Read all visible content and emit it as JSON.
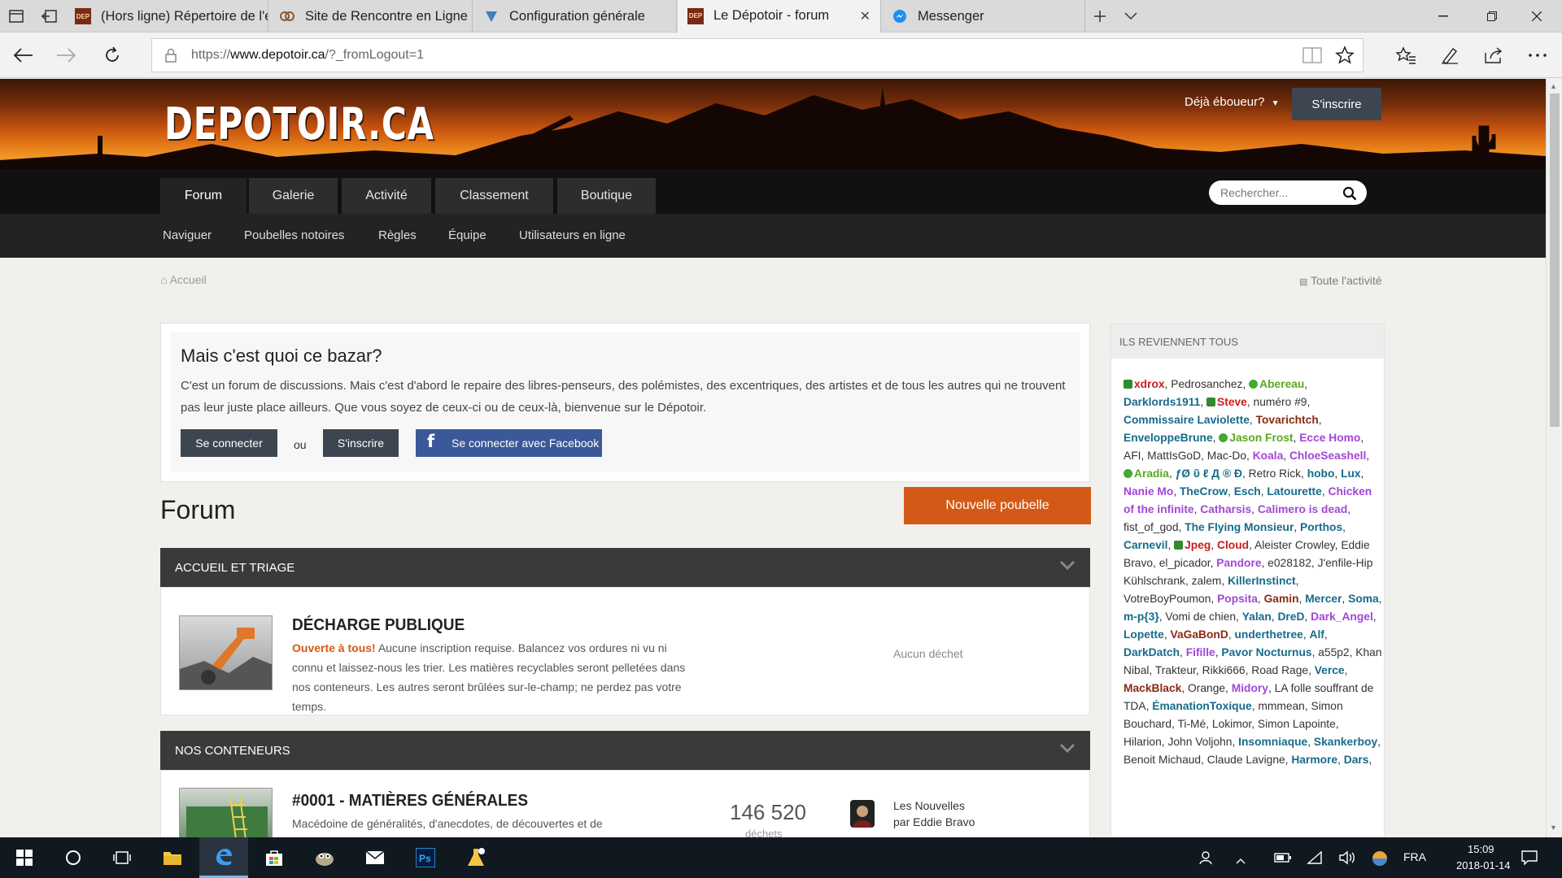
{
  "browser": {
    "tabs": [
      {
        "title": "(Hors ligne) Répertoire de l'é",
        "icon": "depotoir-favicon"
      },
      {
        "title": "Site de Rencontre en Ligne",
        "icon": "dating-site-favicon"
      },
      {
        "title": "Configuration générale",
        "icon": "config-favicon"
      },
      {
        "title": "Le Dépotoir - forum",
        "icon": "depotoir-favicon"
      },
      {
        "title": "Messenger",
        "icon": "messenger-favicon"
      }
    ],
    "url_prefix": "https://",
    "url_domain": "www.depotoir.ca",
    "url_rest": "/?_fromLogout=1"
  },
  "header": {
    "logo": "DEPOTOIR.CA",
    "already_member": "Déjà éboueur?",
    "signup": "S'inscrire",
    "search_placeholder": "Rechercher..."
  },
  "main_nav": [
    "Forum",
    "Galerie",
    "Activité",
    "Classement",
    "Boutique"
  ],
  "sub_nav": [
    "Naviguer",
    "Poubelles notoires",
    "Règles",
    "Équipe",
    "Utilisateurs en ligne"
  ],
  "breadcrumb": "Accueil",
  "all_activity": "Toute l'activité",
  "intro": {
    "title": "Mais c'est quoi ce bazar?",
    "text": "C'est un forum de discussions. Mais c'est d'abord le repaire des libres-penseurs, des polémistes, des excentriques, des artistes et de tous les autres qui ne trouvent pas leur juste place ailleurs. Que vous soyez de ceux-ci ou de ceux-là, bienvenue sur le Dépotoir.",
    "login": "Se connecter",
    "or": "ou",
    "signup": "S'inscrire",
    "facebook": "Se connecter avec Facebook"
  },
  "forum": {
    "title": "Forum",
    "new_button": "Nouvelle poubelle",
    "categories": [
      {
        "title": "ACCUEIL ET TRIAGE",
        "forums": [
          {
            "title": "DÉCHARGE PUBLIQUE",
            "lead": "Ouverte à tous!",
            "desc": " Aucune inscription requise. Balancez vos ordures ni vu ni connu et laissez-nous les trier. Les matières recyclables seront pelletées dans nos conteneurs. Les autres seront brûlées sur-le-champ; ne perdez pas votre temps.",
            "last": "Aucun déchet"
          }
        ]
      },
      {
        "title": "NOS CONTENEURS",
        "forums": [
          {
            "title": "#0001 - MATIÈRES GÉNÉRALES",
            "desc": "Macédoine de généralités, d'anecdotes, de découvertes et de",
            "count": "146 520",
            "count_label": "déchets",
            "last_title": "Les Nouvelles",
            "last_by": "par Eddie Bravo"
          }
        ]
      }
    ]
  },
  "sidebar": {
    "title": "ILS REVIENNENT TOUS"
  },
  "taskbar": {
    "lang": "FRA",
    "time": "15:09",
    "date": "2018-01-14"
  }
}
